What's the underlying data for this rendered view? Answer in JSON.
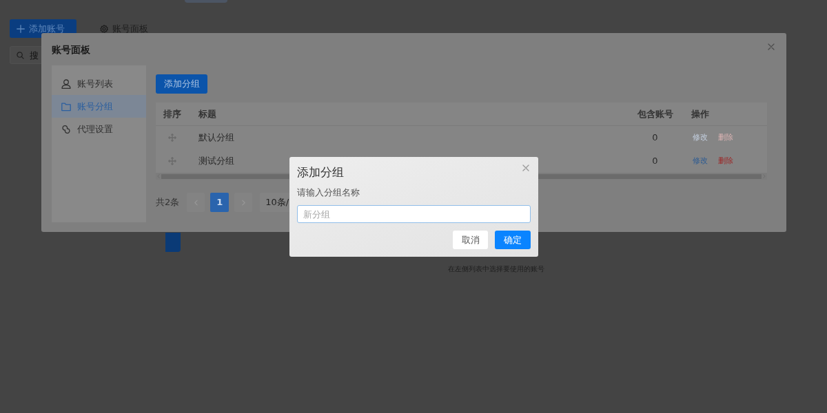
{
  "background": {
    "add_button": "添加账号",
    "panel_tab": "账号面板",
    "search": {
      "placeholder": "搜"
    },
    "hint": "在左侧列表中选择要使用的账号"
  },
  "panel": {
    "title": "账号面板",
    "sidebar": {
      "items": [
        {
          "label": "账号列表",
          "kind": "user",
          "selected": false
        },
        {
          "label": "账号分组",
          "kind": "folder",
          "selected": true
        },
        {
          "label": "代理设置",
          "kind": "link",
          "selected": false
        }
      ]
    },
    "add_group_button": "添加分组",
    "table": {
      "columns": [
        "排序",
        "标题",
        "包含账号",
        "操作"
      ],
      "rows": [
        {
          "title": "默认分组",
          "accounts": "0",
          "actions": [
            {
              "label": "修改",
              "kind": "edit",
              "disabled": true
            },
            {
              "label": "删除",
              "kind": "delete",
              "disabled": true
            }
          ]
        },
        {
          "title": "测试分组",
          "accounts": "0",
          "actions": [
            {
              "label": "修改",
              "kind": "edit",
              "disabled": false
            },
            {
              "label": "删除",
              "kind": "delete",
              "disabled": false
            }
          ]
        }
      ]
    },
    "pagination": {
      "total": "共2条",
      "pages": [
        {
          "label": "1",
          "selected": true
        }
      ],
      "page_size": "10条/"
    }
  },
  "dialog": {
    "title": "添加分组",
    "label": "请输入分组名称",
    "input": {
      "placeholder": "新分组"
    },
    "buttons": [
      {
        "label": "取消",
        "kind": "secondary"
      },
      {
        "label": "确定",
        "kind": "primary"
      }
    ]
  }
}
